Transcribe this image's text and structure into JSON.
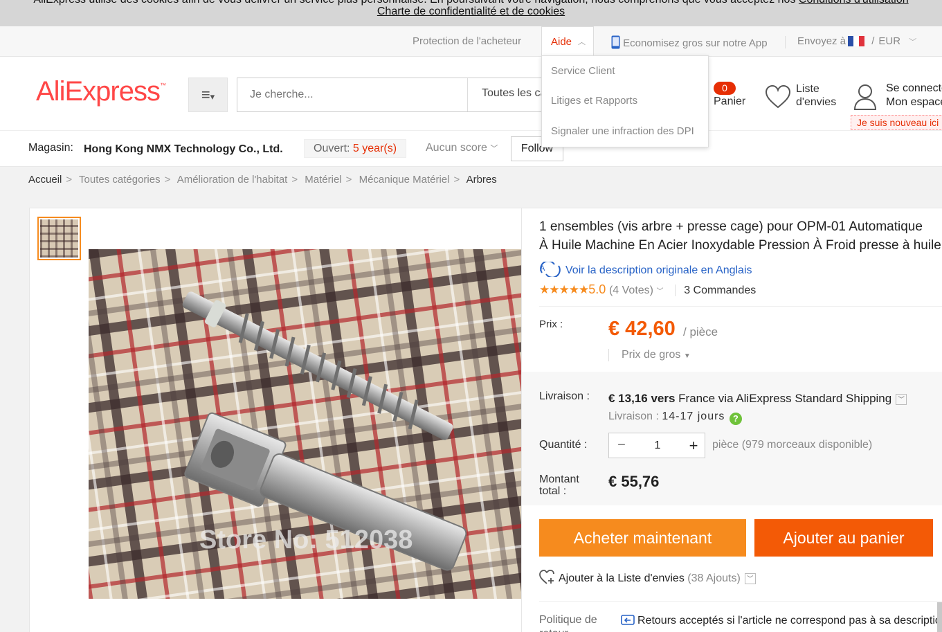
{
  "cookie": {
    "line1": "AliExpress utilise des cookies afin de vous délivrer un service plus personnalisé. En poursuivant votre navigation, nous comprenons que vous acceptez nos",
    "line1_link": "Conditions d'utilisation",
    "line2_link": "Charte de confidentialité et de cookies"
  },
  "topbar": {
    "buyer_protection": "Protection de l'acheteur",
    "help": "Aide",
    "app": "Economisez gros sur notre App",
    "ship_to": "Envoyez à",
    "currency_sep": "/",
    "currency": "EUR"
  },
  "help_menu": {
    "items": [
      "Service Client",
      "Litiges et Rapports",
      "Signaler une infraction des DPI"
    ]
  },
  "header": {
    "logo": "AliExpress",
    "search_placeholder": "Je cherche...",
    "category": "Toutes les catégories",
    "cart_count": "0",
    "cart_label": "Panier",
    "wishlist_line1": "Liste",
    "wishlist_line2": "d'envies",
    "login_line1": "Se connecter",
    "login_line2": "Mon espace",
    "newbie": "Je suis nouveau ici"
  },
  "store": {
    "label": "Magasin:",
    "name": "Hong Kong NMX Technology Co., Ltd.",
    "opened_label": "Ouvert:",
    "opened_value": "5 year(s)",
    "score": "Aucun score",
    "follow": "Follow"
  },
  "breadcrumb": [
    "Accueil",
    "Toutes catégories",
    "Amélioration de l'habitat",
    "Matériel",
    "Mécanique Matériel",
    "Arbres"
  ],
  "product": {
    "title_line1": "1 ensembles (vis arbre + presse cage) pour OPM-01 Automatique",
    "title_line2": "À Huile Machine En Acier Inoxydable Pression À Froid presse à huile",
    "translate": "Voir la description originale en Anglais",
    "rating": "5.0",
    "votes": "(4 Votes)",
    "orders": "3 Commandes",
    "watermark": "Store No: 512038",
    "price_label": "Prix :",
    "price": "€ 42,60",
    "per": "/ pièce",
    "bulk": "Prix de gros",
    "shipping_label": "Livraison :",
    "shipping_price": "€ 13,16 vers",
    "shipping_via": "France via AliExpress Standard Shipping",
    "delivery_label": "Livraison :",
    "delivery_days": "14-17 jours",
    "qty_label": "Quantité :",
    "qty_value": "1",
    "qty_unit": "pièce",
    "qty_avail": "(979 morceaux disponible)",
    "total_label_1": "Montant",
    "total_label_2": "total :",
    "total": "€ 55,76",
    "buy_now": "Acheter maintenant",
    "add_cart": "Ajouter au panier",
    "add_wishlist": "Ajouter à la Liste d'envies",
    "wishlist_count": "(38 Ajouts)",
    "policy_label_1": "Politique de",
    "policy_label_2": "retour",
    "policy_text": "Retours acceptés si l'article ne correspond pas à sa description"
  },
  "colors": {
    "brand": "#ff4747",
    "accent": "#f35a06",
    "buy": "#f68b1e",
    "link": "#2762c6"
  }
}
